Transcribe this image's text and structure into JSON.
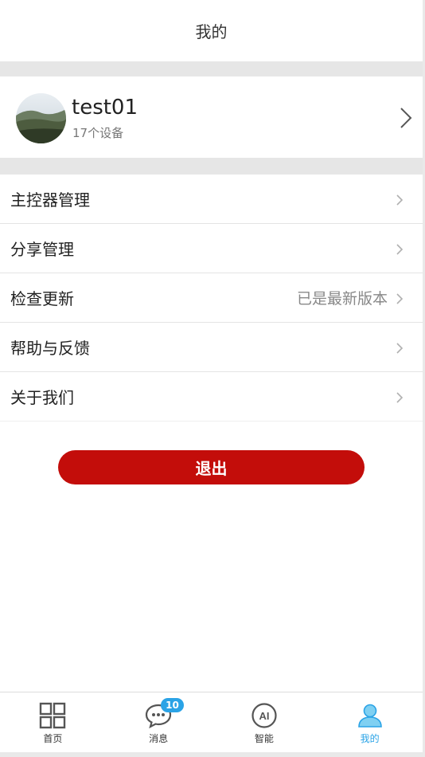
{
  "header": {
    "title": "我的"
  },
  "profile": {
    "name": "test01",
    "subtitle": "17个设备"
  },
  "menu": {
    "items": [
      {
        "label": "主控器管理",
        "value": ""
      },
      {
        "label": "分享管理",
        "value": ""
      },
      {
        "label": "检查更新",
        "value": "已是最新版本"
      },
      {
        "label": "帮助与反馈",
        "value": ""
      },
      {
        "label": "关于我们",
        "value": ""
      }
    ]
  },
  "logout": {
    "label": "退出"
  },
  "tabbar": {
    "tabs": [
      {
        "label": "首页",
        "icon": "grid-icon"
      },
      {
        "label": "消息",
        "icon": "chat-bubble-icon",
        "badge": "10"
      },
      {
        "label": "智能",
        "icon": "ai-icon"
      },
      {
        "label": "我的",
        "icon": "user-icon",
        "active": true
      }
    ]
  },
  "colors": {
    "accent": "#2aa3e6",
    "logout": "#c30d0a",
    "separator": "#e6e6e6"
  }
}
